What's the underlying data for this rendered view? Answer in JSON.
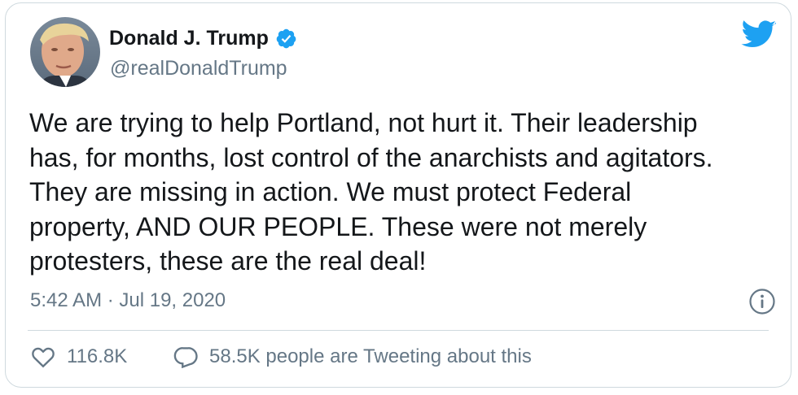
{
  "author": {
    "name": "Donald J. Trump",
    "handle": "@realDonaldTrump",
    "verified": true,
    "avatar": "profile-photo"
  },
  "brand": {
    "icon": "twitter-bird-icon",
    "color": "#1da1f2"
  },
  "tweet": {
    "text": "We are trying to help Portland, not hurt it. Their leadership\nhas, for months, lost control of the anarchists and agitators.\nThey are missing in action. We must protect Federal\nproperty, AND OUR PEOPLE. These were not merely\nprotesters, these are the real deal!",
    "timestamp": "5:42 AM · Jul 19, 2020"
  },
  "actions": {
    "likes": "116.8K",
    "discussion": "58.5K people are Tweeting about this"
  },
  "colors": {
    "text": "#14171a",
    "secondary": "#657786",
    "border": "#cfd9de"
  }
}
